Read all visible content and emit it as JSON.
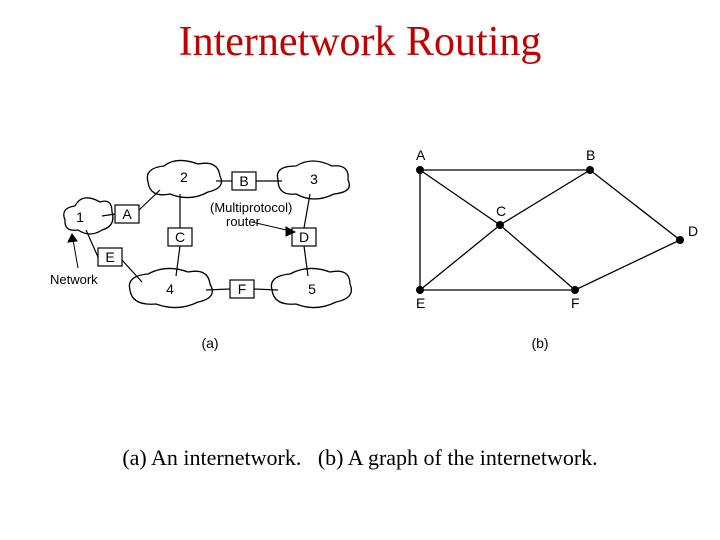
{
  "title": "Internetwork Routing",
  "caption_a": "(a) An internetwork.",
  "caption_b": "(b)  A graph of the internetwork.",
  "fig_a": {
    "label": "(a)",
    "network_arrow_label": "Network",
    "router_label_1": "(Multiprotocol)",
    "router_label_2": "router",
    "routers": {
      "A": "A",
      "B": "B",
      "C": "C",
      "D": "D",
      "E": "E",
      "F": "F"
    },
    "networks": {
      "1": "1",
      "2": "2",
      "3": "3",
      "4": "4",
      "5": "5"
    },
    "topology_description": "Router A connects to networks 1 and 2; B connects to 2 and 3; C connects to 2 and 4; D connects to 3 and 5; E connects to 1 and 4; F connects to 4 and 5."
  },
  "fig_b": {
    "label": "(b)",
    "nodes": [
      "A",
      "B",
      "C",
      "D",
      "E",
      "F"
    ],
    "edges": [
      [
        "A",
        "B"
      ],
      [
        "A",
        "C"
      ],
      [
        "A",
        "E"
      ],
      [
        "B",
        "C"
      ],
      [
        "B",
        "D"
      ],
      [
        "C",
        "E"
      ],
      [
        "C",
        "F"
      ],
      [
        "E",
        "F"
      ],
      [
        "F",
        "D"
      ]
    ]
  }
}
